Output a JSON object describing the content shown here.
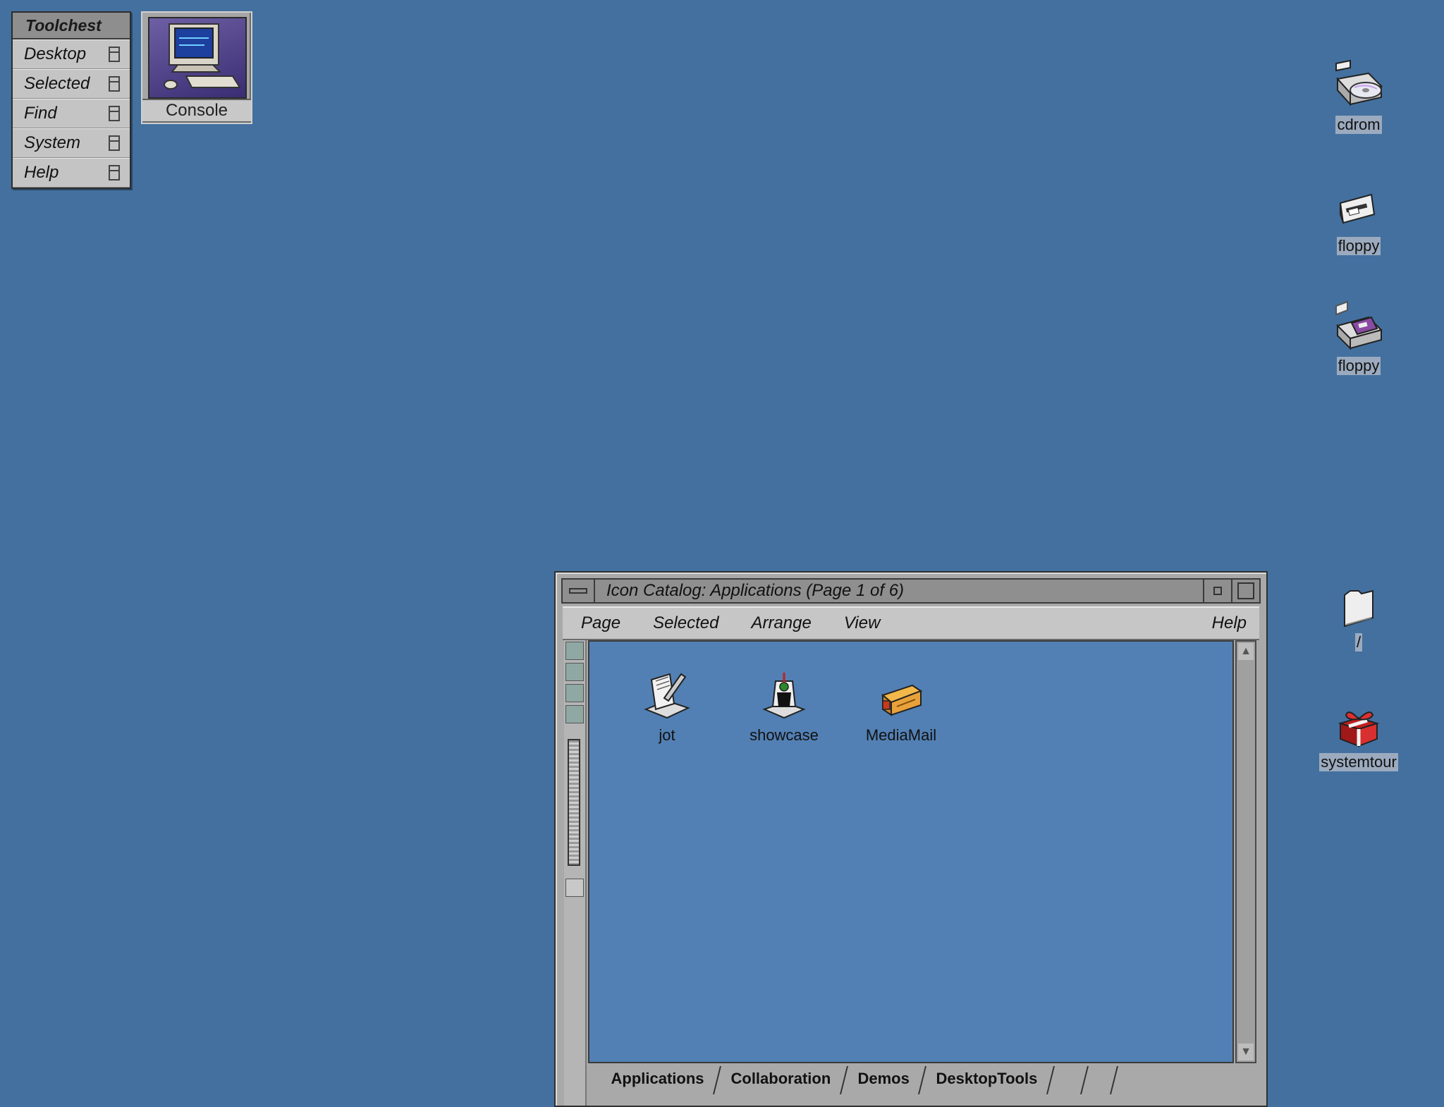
{
  "toolchest": {
    "title": "Toolchest",
    "items": [
      {
        "label": "Desktop"
      },
      {
        "label": "Selected"
      },
      {
        "label": "Find"
      },
      {
        "label": "System"
      },
      {
        "label": "Help"
      }
    ]
  },
  "console": {
    "label": "Console"
  },
  "desktop_icons": [
    {
      "label": "cdrom",
      "icon": "cdrom-icon"
    },
    {
      "label": "floppy",
      "icon": "floppy-icon"
    },
    {
      "label": "floppy",
      "icon": "floppy-icon"
    },
    {
      "label": "/",
      "icon": "folder-icon"
    },
    {
      "label": "systemtour",
      "icon": "gift-icon"
    }
  ],
  "catalog_window": {
    "title": "Icon Catalog: Applications (Page 1 of 6)",
    "menu": {
      "page": "Page",
      "selected": "Selected",
      "arrange": "Arrange",
      "view": "View",
      "help": "Help"
    },
    "icons": [
      {
        "label": "jot",
        "icon": "jot-notepad-icon"
      },
      {
        "label": "showcase",
        "icon": "showcase-icon"
      },
      {
        "label": "MediaMail",
        "icon": "mailbox-icon"
      }
    ],
    "tabs": [
      "Applications",
      "Collaboration",
      "Demos",
      "DesktopTools"
    ]
  },
  "colors": {
    "desktop_bg": "#43709f",
    "catalog_bg": "#5280b4",
    "chrome_gray": "#a9a9a9"
  }
}
